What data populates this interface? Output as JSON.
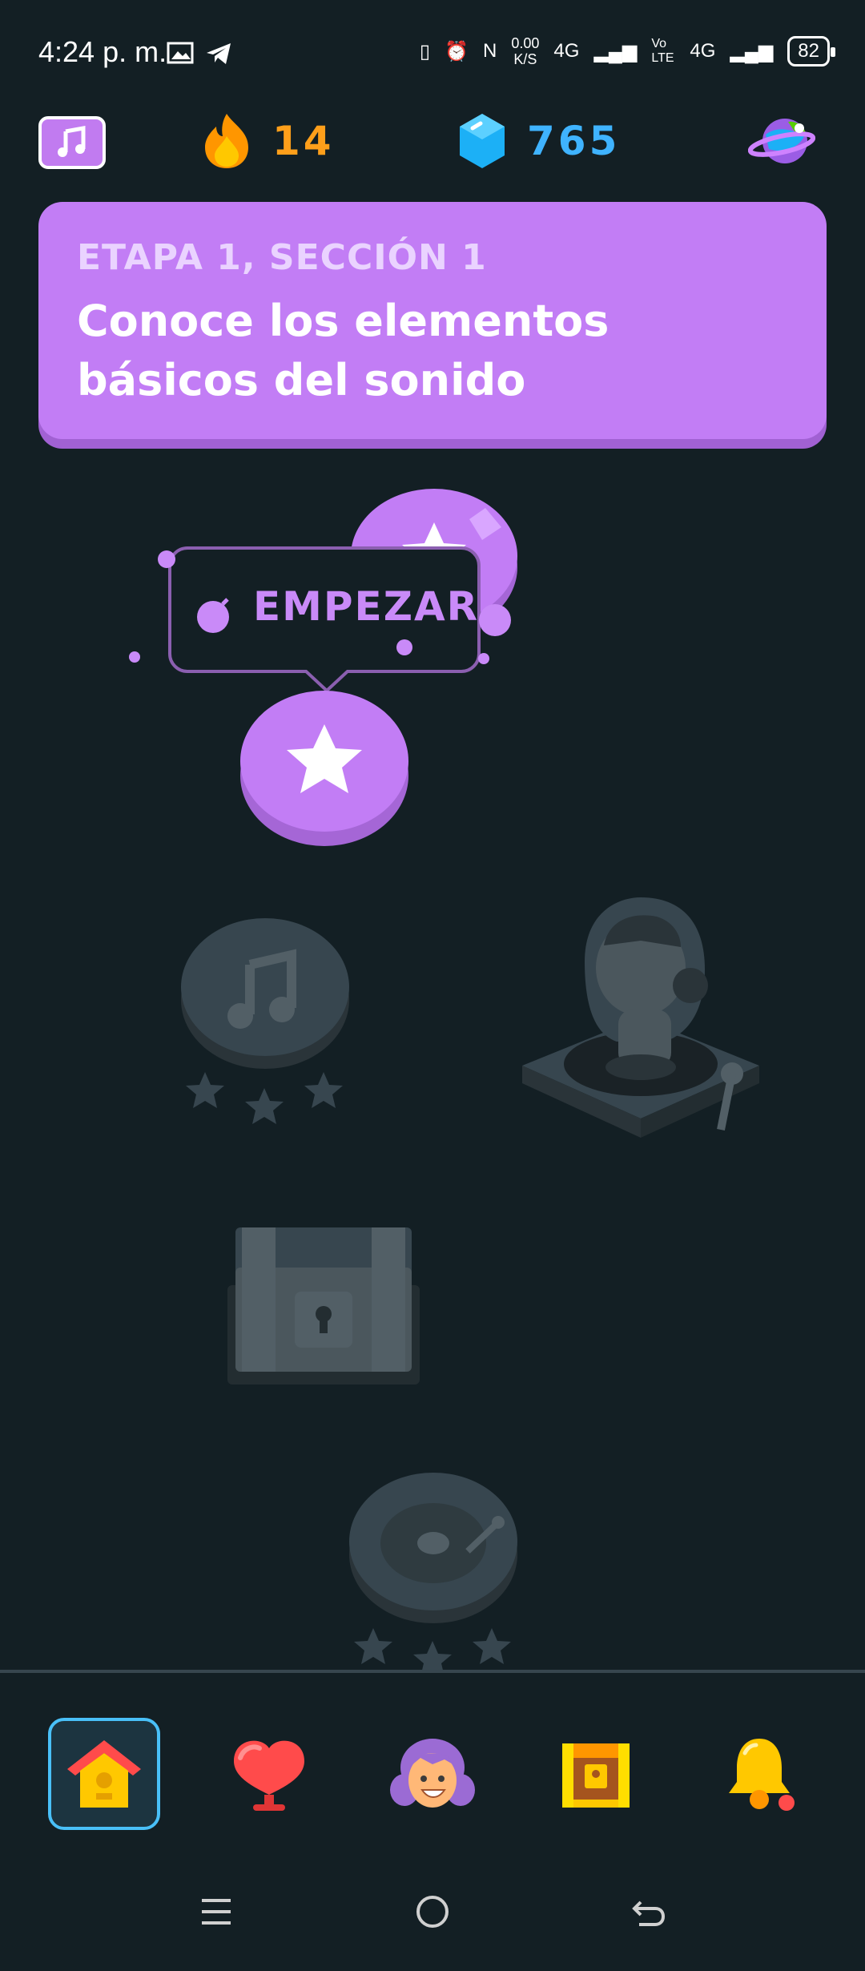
{
  "status_bar": {
    "time": "4:24 p. m.",
    "speed_value": "0.00",
    "speed_unit": "K/S",
    "network_1": "4G",
    "volte": "Vo LTE",
    "network_2": "4G",
    "battery": "82"
  },
  "top_bar": {
    "streak_count": "14",
    "gems_count": "765"
  },
  "unit": {
    "subtitle": "ETAPA 1, SECCIÓN 1",
    "title": "Conoce los elementos básicos del sonido"
  },
  "path": {
    "start_label": "EMPEZAR"
  },
  "colors": {
    "background": "#131f24",
    "accent_purple": "#c27df5",
    "streak_orange": "#ff9f1a",
    "gems_blue": "#3fb3ff",
    "locked_gray": "#37464f"
  },
  "icons": {
    "course": "music-note-icon",
    "streak": "flame-icon",
    "gems": "gem-icon",
    "profile": "globe-icon",
    "nav": [
      "home-icon",
      "heart-icon",
      "character-icon",
      "chest-icon",
      "bell-icon"
    ]
  }
}
